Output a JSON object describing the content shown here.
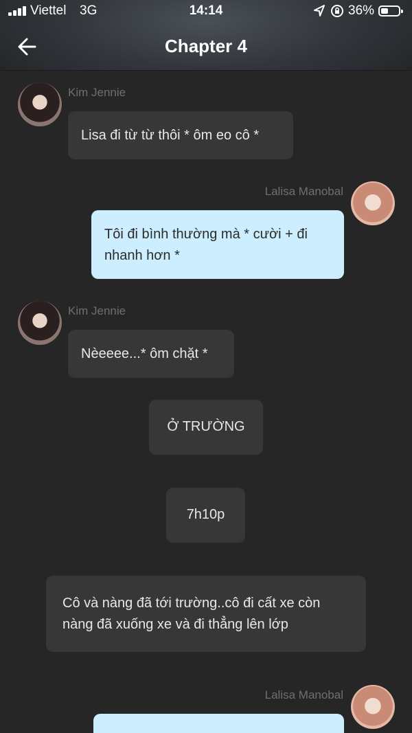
{
  "status_bar": {
    "carrier": "Viettel",
    "network": "3G",
    "time": "14:14",
    "battery": "36%"
  },
  "nav": {
    "title": "Chapter 4"
  },
  "messages": [
    {
      "sender": "Kim Jennie",
      "text": "Lisa đi từ từ thôi * ôm eo cô *"
    },
    {
      "sender": "Lalisa Manobal",
      "text": "Tôi đi bình thường mà * cười + đi nhanh hơn *"
    },
    {
      "sender": "Kim Jennie",
      "text": "Nèeeee...* ôm chặt *"
    },
    {
      "text": "Ở TRƯỜNG"
    },
    {
      "text": "7h10p"
    },
    {
      "text": "Cô và nàng đã tới trường..cô đi cất xe còn nàng đã xuống xe và đi thẳng lên lớp"
    },
    {
      "sender": "Lalisa Manobal",
      "text": ""
    }
  ],
  "colors": {
    "background": "#262626",
    "left_bubble": "#373737",
    "right_bubble": "#cdeeff",
    "sender_name": "#6f6f6f"
  }
}
